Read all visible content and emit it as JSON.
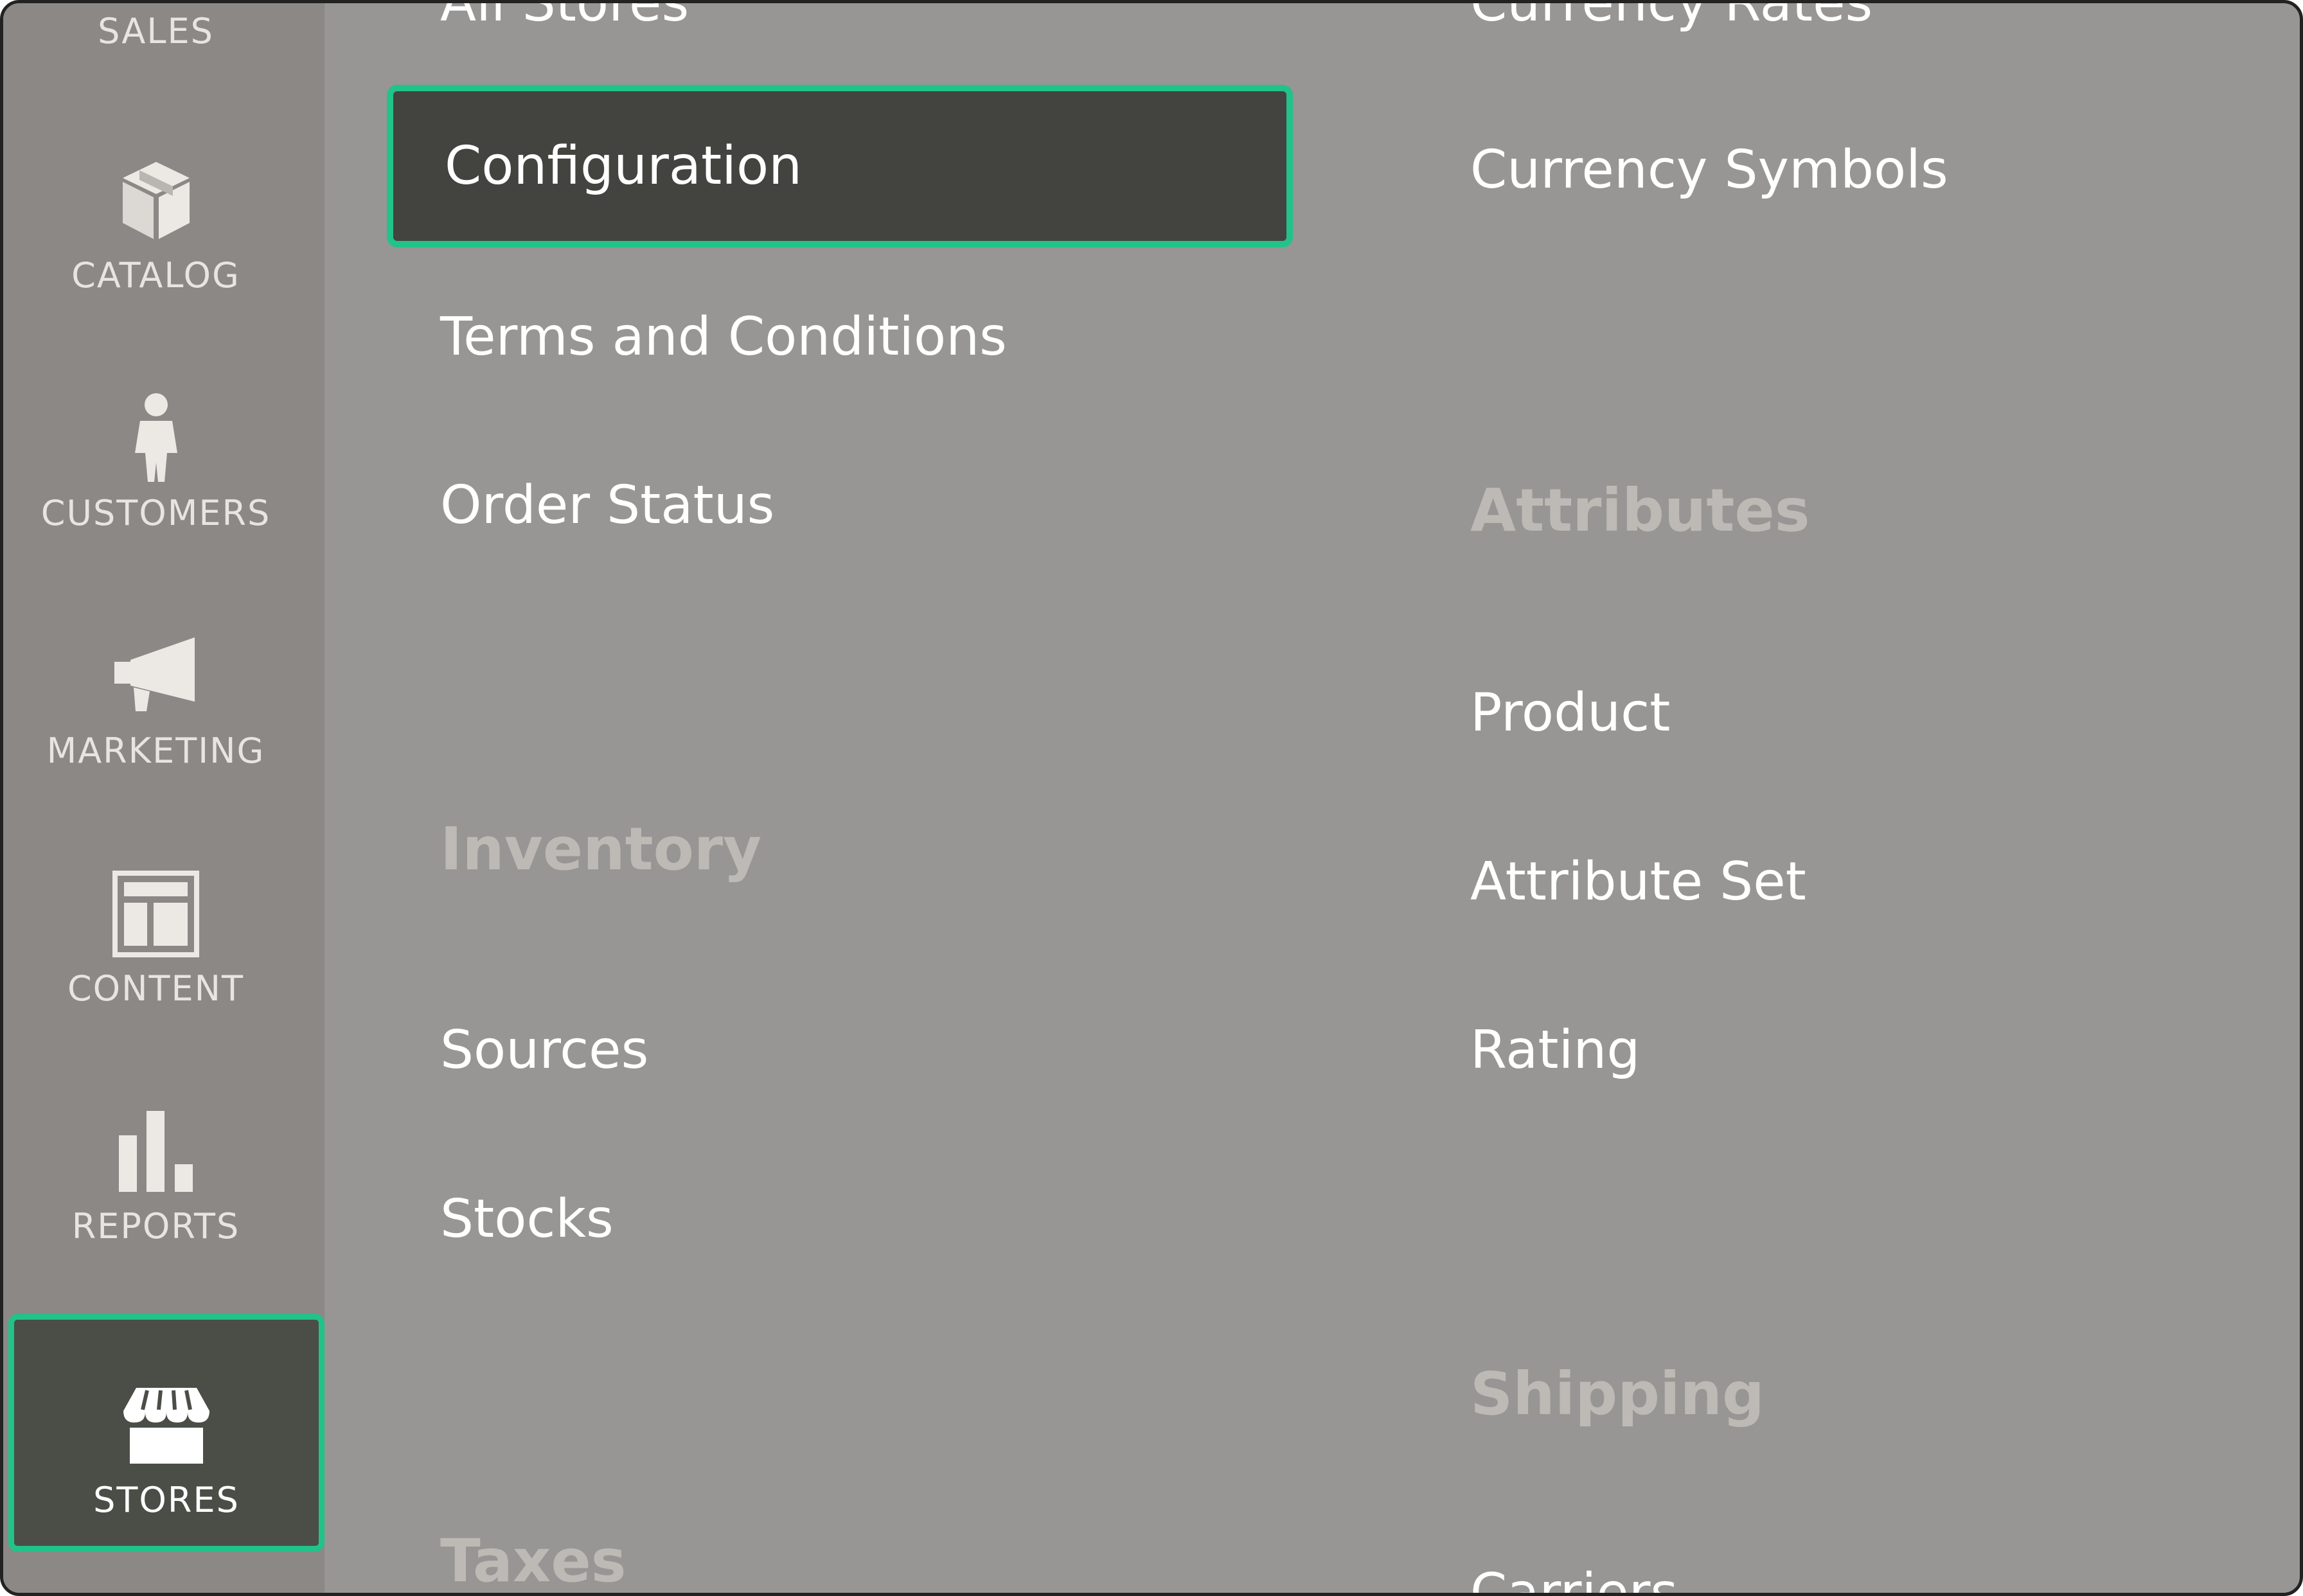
{
  "sidebar": {
    "items": [
      {
        "label": "SALES",
        "icon": "dollar-icon"
      },
      {
        "label": "CATALOG",
        "icon": "box-icon"
      },
      {
        "label": "CUSTOMERS",
        "icon": "person-icon"
      },
      {
        "label": "MARKETING",
        "icon": "megaphone-icon"
      },
      {
        "label": "CONTENT",
        "icon": "layout-icon"
      },
      {
        "label": "REPORTS",
        "icon": "bar-chart-icon"
      },
      {
        "label": "STORES",
        "icon": "storefront-icon",
        "active": true
      }
    ]
  },
  "menu": {
    "col1": {
      "top_partial": "All Stores",
      "configuration": "Configuration",
      "terms": "Terms and Conditions",
      "order_status": "Order Status",
      "inventory_heading": "Inventory",
      "sources": "Sources",
      "stocks": "Stocks",
      "taxes_heading": "Taxes"
    },
    "col2": {
      "top_partial": "Currency Rates",
      "currency_symbols": "Currency Symbols",
      "attributes_heading": "Attributes",
      "product": "Product",
      "attribute_set": "Attribute Set",
      "rating": "Rating",
      "shipping_heading": "Shipping",
      "carriers_partial": "Carriers"
    }
  },
  "colors": {
    "accent": "#21c389",
    "overlay": "#979694",
    "active_bg": "#43443f"
  }
}
